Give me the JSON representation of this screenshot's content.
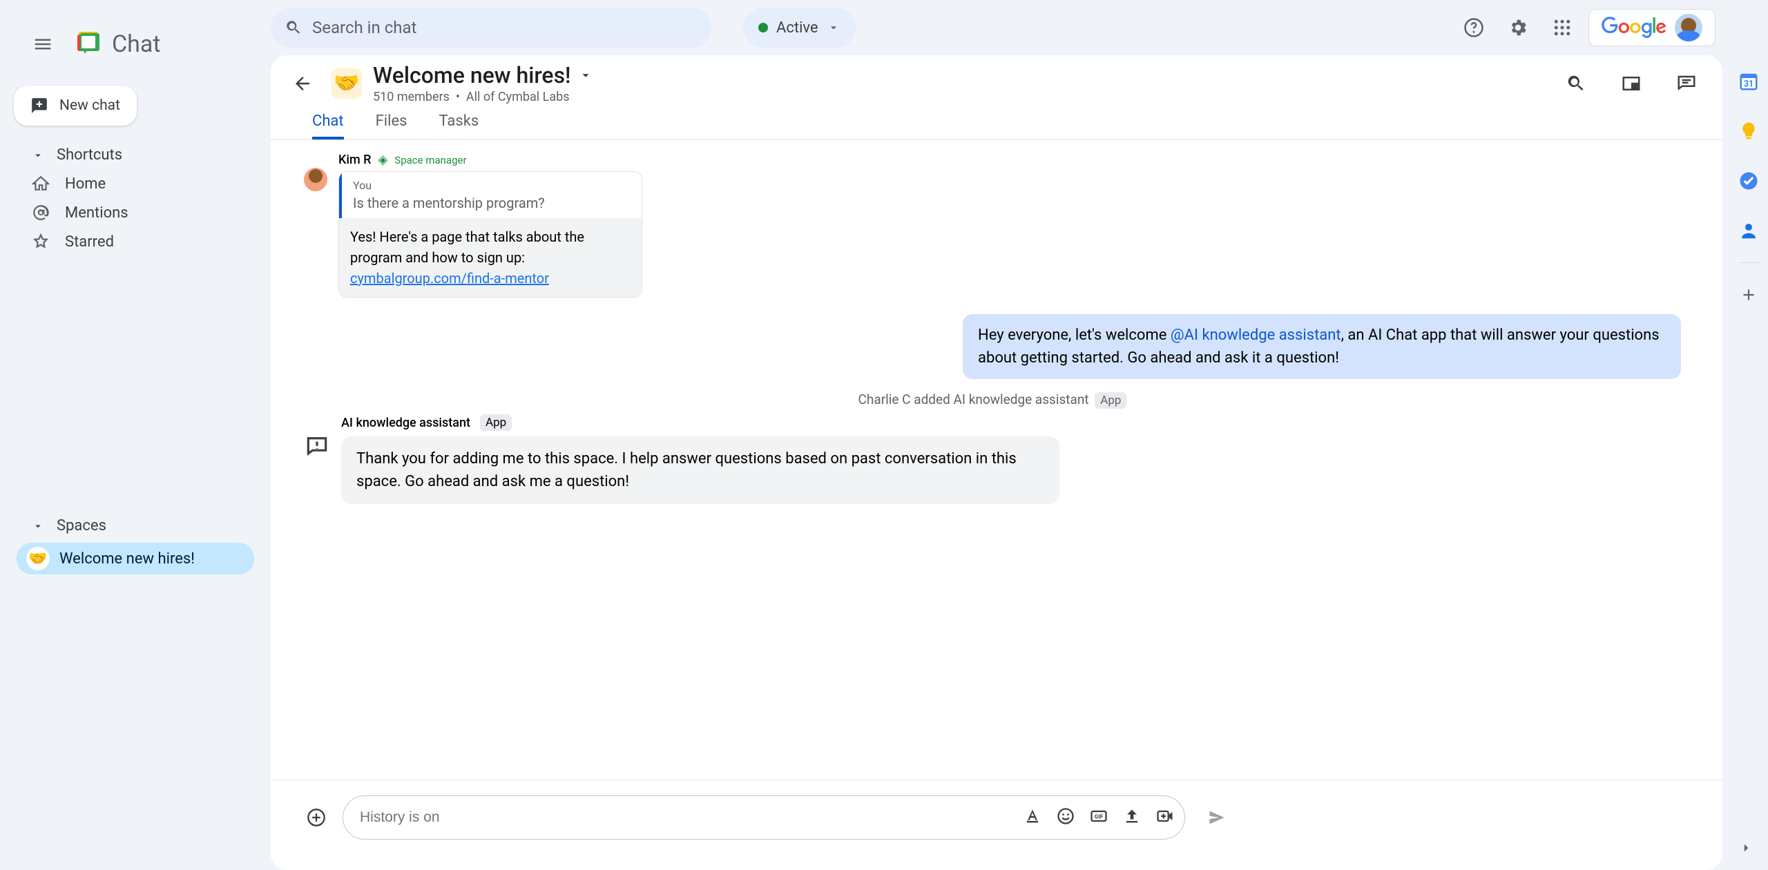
{
  "app_name": "Chat",
  "search": {
    "placeholder": "Search in chat"
  },
  "status": {
    "label": "Active"
  },
  "new_chat": "New chat",
  "shortcuts": {
    "header": "Shortcuts",
    "items": [
      {
        "label": "Home",
        "icon": "home"
      },
      {
        "label": "Mentions",
        "icon": "at"
      },
      {
        "label": "Starred",
        "icon": "star"
      }
    ]
  },
  "spaces": {
    "header": "Spaces",
    "items": [
      {
        "label": "Welcome new hires!",
        "emoji": "🤝",
        "selected": true
      }
    ]
  },
  "space": {
    "title": "Welcome new hires!",
    "members": "510 members",
    "scope": "All of Cymbal Labs"
  },
  "tabs": [
    {
      "label": "Chat",
      "active": true
    },
    {
      "label": "Files",
      "active": false
    },
    {
      "label": "Tasks",
      "active": false
    }
  ],
  "messages": {
    "kim": {
      "author": "Kim R",
      "role": "Space manager",
      "quoted_label": "You",
      "quoted_text": "Is there a mentorship program?",
      "reply_text": "Yes! Here's a page that talks about the program and how to sign up:",
      "reply_link": "cymbalgroup.com/find-a-mentor"
    },
    "outgoing": {
      "prefix": "Hey everyone, let's welcome ",
      "mention": "@AI knowledge assistant",
      "suffix": ", an AI Chat app that will answer your questions about getting started.  Go ahead and ask it a question!"
    },
    "system": {
      "text": "Charlie C added AI knowledge assistant",
      "badge": "App"
    },
    "ai": {
      "author": "AI knowledge assistant",
      "badge": "App",
      "text": "Thank you for adding me to this space. I help answer questions based on past conversation in this space. Go ahead and ask me a question!"
    }
  },
  "compose": {
    "placeholder": "History is on"
  },
  "google_label": "Google"
}
